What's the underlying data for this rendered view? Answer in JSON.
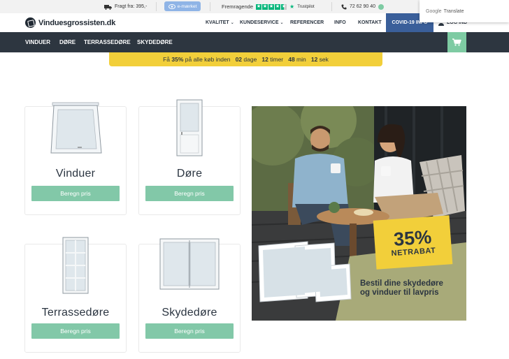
{
  "topbar": {
    "shipping": "Fragt fra: 395,-",
    "emarket": "e-mærket",
    "rating_label": "Fremragende",
    "trustpilot": "Trustpilot",
    "phone": "72 62 90 40"
  },
  "translate": {
    "brand": "Google",
    "label": "Translate"
  },
  "header": {
    "logo": "Vinduesgrossisten.dk",
    "nav": [
      "KVALITET",
      "KUNDESERVICE",
      "REFERENCER",
      "INFO",
      "KONTAKT"
    ],
    "covid": "COVID-19 INFO",
    "login": "LOG IND"
  },
  "categories": [
    "VINDUER",
    "DØRE",
    "TERRASSEDØRE",
    "SKYDEDØRE"
  ],
  "promo": {
    "prefix": "Få ",
    "percent": "35%",
    "middle": " på alle køb inden   ",
    "days_num": "02",
    "days_label": " dage   ",
    "hours_num": "12",
    "hours_label": " timer   ",
    "min_num": "48",
    "min_label": " min   ",
    "sec_num": "12",
    "sec_label": " sek"
  },
  "products": [
    {
      "title": "Vinduer",
      "button": "Beregn pris"
    },
    {
      "title": "Døre",
      "button": "Beregn pris"
    },
    {
      "title": "Terrassedøre",
      "button": "Beregn pris"
    },
    {
      "title": "Skydedøre",
      "button": "Beregn pris"
    }
  ],
  "banner": {
    "percent": "35%",
    "label": "NETRABAT",
    "text_line1": "Bestil dine skydedøre",
    "text_line2": "og vinduer til lavpris"
  },
  "colors": {
    "nav_dark": "#2d3640",
    "accent_green": "#82c8a8",
    "promo_yellow": "#f2cf3a",
    "covid_blue": "#3a5f9a",
    "trustpilot_green": "#00b67a"
  }
}
